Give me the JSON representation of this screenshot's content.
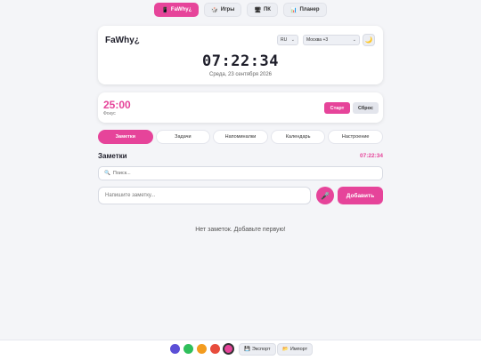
{
  "nav": {
    "items": [
      {
        "icon": "📱",
        "label": "FaWhy¿",
        "active": true
      },
      {
        "icon": "🎲",
        "label": "Игры",
        "active": false
      },
      {
        "icon": "🖥",
        "label": "ПК",
        "active": false
      },
      {
        "icon": "📊",
        "label": "Планер",
        "active": false
      }
    ]
  },
  "clock_card": {
    "brand": "FaWhy¿",
    "language": "RU",
    "timezone": "Москва +3",
    "theme_icon": "🌙",
    "time": "07:22:34",
    "date": "Среда, 23 сентября 2026"
  },
  "timer_card": {
    "time": "25:00",
    "mode": "Фокус",
    "start_label": "Старт",
    "reset_label": "Сброс"
  },
  "tabs": [
    "Заметки",
    "Задачи",
    "Напоминалки",
    "Календарь",
    "Настроение"
  ],
  "notes": {
    "title": "Заметки",
    "time": "07:22:34",
    "search_icon": "🔍",
    "search_placeholder": "Поиск...",
    "input_placeholder": "Напишите заметку...",
    "mic_icon": "🎤",
    "add_label": "Добавить",
    "empty_text": "Нет заметок. Добавьте первую!"
  },
  "footer": {
    "colors": [
      "#5b4fd6",
      "#2fbf5b",
      "#f39c1f",
      "#e74c3c",
      "#e6449a"
    ],
    "export_icon": "💾",
    "export_label": "Экспорт",
    "import_icon": "📂",
    "import_label": "Импорт"
  },
  "accent": "#e6449a"
}
